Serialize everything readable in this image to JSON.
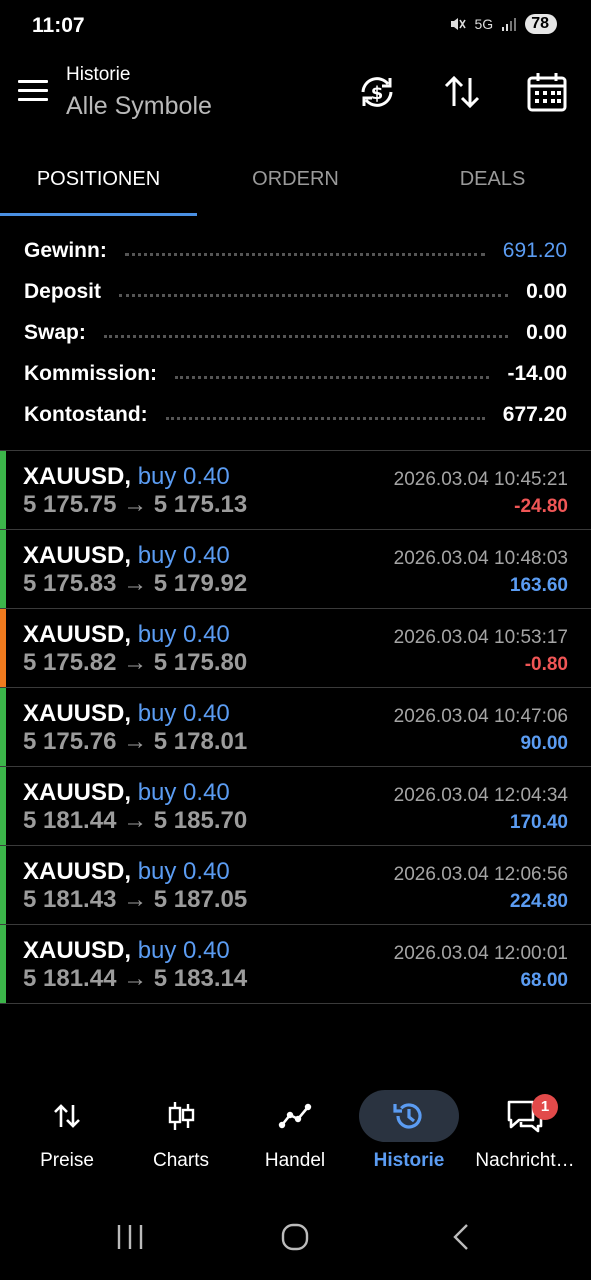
{
  "status_bar": {
    "time": "11:07",
    "battery": "78",
    "network": "5G"
  },
  "header": {
    "title": "Historie",
    "subtitle": "Alle Symbole"
  },
  "tabs": [
    {
      "label": "POSITIONEN",
      "active": true
    },
    {
      "label": "ORDERN",
      "active": false
    },
    {
      "label": "DEALS",
      "active": false
    }
  ],
  "summary": [
    {
      "label": "Gewinn:",
      "value": "691.20"
    },
    {
      "label": "Deposit",
      "value": "0.00"
    },
    {
      "label": "Swap:",
      "value": "0.00"
    },
    {
      "label": "Kommission:",
      "value": "-14.00"
    },
    {
      "label": "Kontostand:",
      "value": "677.20"
    }
  ],
  "deals": [
    {
      "symbol": "XAUUSD,",
      "side": "buy 0.40",
      "open": "5 175.75",
      "arrow": "→",
      "close": "5 175.13",
      "time": "2026.03.04 10:45:21",
      "profit": "-24.80",
      "bar_color": "#3cb54a"
    },
    {
      "symbol": "XAUUSD,",
      "side": "buy 0.40",
      "open": "5 175.83",
      "arrow": "→",
      "close": "5 179.92",
      "time": "2026.03.04 10:48:03",
      "profit": "163.60",
      "bar_color": "#3cb54a"
    },
    {
      "symbol": "XAUUSD,",
      "side": "buy 0.40",
      "open": "5 175.82",
      "arrow": "→",
      "close": "5 175.80",
      "time": "2026.03.04 10:53:17",
      "profit": "-0.80",
      "bar_color": "#f07a1e"
    },
    {
      "symbol": "XAUUSD,",
      "side": "buy 0.40",
      "open": "5 175.76",
      "arrow": "→",
      "close": "5 178.01",
      "time": "2026.03.04 10:47:06",
      "profit": "90.00",
      "bar_color": "#3cb54a"
    },
    {
      "symbol": "XAUUSD,",
      "side": "buy 0.40",
      "open": "5 181.44",
      "arrow": "→",
      "close": "5 185.70",
      "time": "2026.03.04 12:04:34",
      "profit": "170.40",
      "bar_color": "#3cb54a"
    },
    {
      "symbol": "XAUUSD,",
      "side": "buy 0.40",
      "open": "5 181.43",
      "arrow": "→",
      "close": "5 187.05",
      "time": "2026.03.04 12:06:56",
      "profit": "224.80",
      "bar_color": "#3cb54a"
    },
    {
      "symbol": "XAUUSD,",
      "side": "buy 0.40",
      "open": "5 181.44",
      "arrow": "→",
      "close": "5 183.14",
      "time": "2026.03.04 12:00:01",
      "profit": "68.00",
      "bar_color": "#3cb54a"
    }
  ],
  "bottom_nav": [
    {
      "label": "Preise",
      "icon": "prices-arrows-icon"
    },
    {
      "label": "Charts",
      "icon": "candlestick-icon"
    },
    {
      "label": "Handel",
      "icon": "trade-line-icon"
    },
    {
      "label": "Historie",
      "icon": "history-clock-icon",
      "active": true
    },
    {
      "label": "Nachricht…",
      "icon": "messages-icon",
      "badge": "1"
    }
  ],
  "colors": {
    "accent": "#5b9cf2",
    "negative": "#f05656",
    "positive_bar": "#3cb54a",
    "warning_bar": "#f07a1e"
  }
}
